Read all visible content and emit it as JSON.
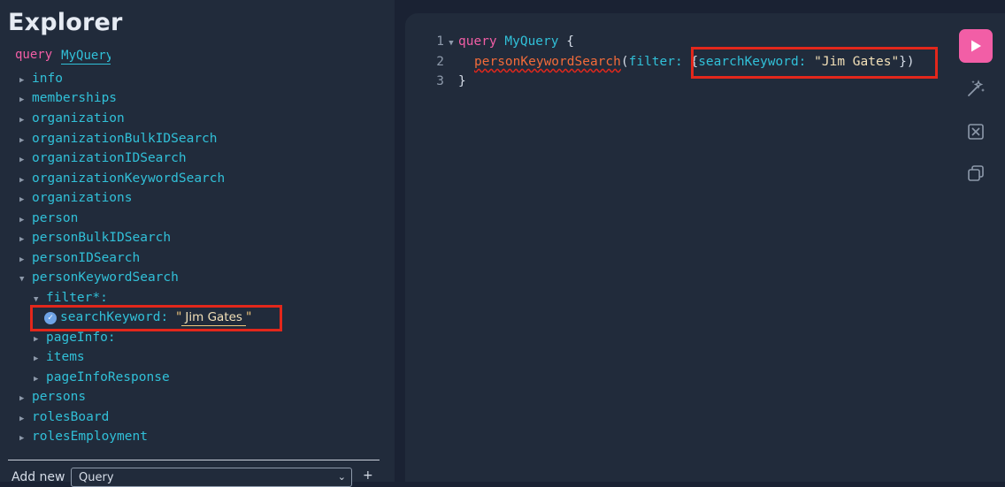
{
  "explorer": {
    "title": "Explorer",
    "query_keyword": "query",
    "operation_name": "MyQuery",
    "items": [
      {
        "label": "info"
      },
      {
        "label": "memberships"
      },
      {
        "label": "organization"
      },
      {
        "label": "organizationBulkIDSearch"
      },
      {
        "label": "organizationIDSearch"
      },
      {
        "label": "organizationKeywordSearch"
      },
      {
        "label": "organizations"
      },
      {
        "label": "person"
      },
      {
        "label": "personBulkIDSearch"
      },
      {
        "label": "personIDSearch"
      },
      {
        "label": "personKeywordSearch"
      }
    ],
    "expanded": {
      "filter_label": "filter*:",
      "search_keyword_label": "searchKeyword:",
      "search_keyword_value": "Jim Gates",
      "quote": "\"",
      "children": [
        {
          "label": "pageInfo:"
        },
        {
          "label": "items"
        },
        {
          "label": "pageInfoResponse"
        }
      ]
    },
    "items_after": [
      {
        "label": "persons"
      },
      {
        "label": "rolesBoard"
      },
      {
        "label": "rolesEmployment"
      }
    ],
    "add_new_label": "Add new",
    "add_new_select": "Query",
    "add_new_plus": "+"
  },
  "editor": {
    "line_numbers": [
      "1",
      "2",
      "3"
    ],
    "line1": {
      "keyword": "query",
      "name": "MyQuery",
      "brace": "{"
    },
    "line2": {
      "field": "personKeywordSearch",
      "open_paren": "(",
      "arg": "filter:",
      "open_brace": "{",
      "key": "searchKeyword:",
      "value": "\"Jim Gates\"",
      "close": "})"
    },
    "line3": {
      "brace": "}"
    }
  },
  "toolbar": {
    "run_icon": "play-icon",
    "prettify_icon": "magic-wand-icon",
    "merge_icon": "merge-fragments-icon",
    "copy_icon": "copy-icon"
  },
  "colors": {
    "accent": "#f25ea6",
    "field": "#31c0d8",
    "highlight_box": "#e3271b"
  }
}
